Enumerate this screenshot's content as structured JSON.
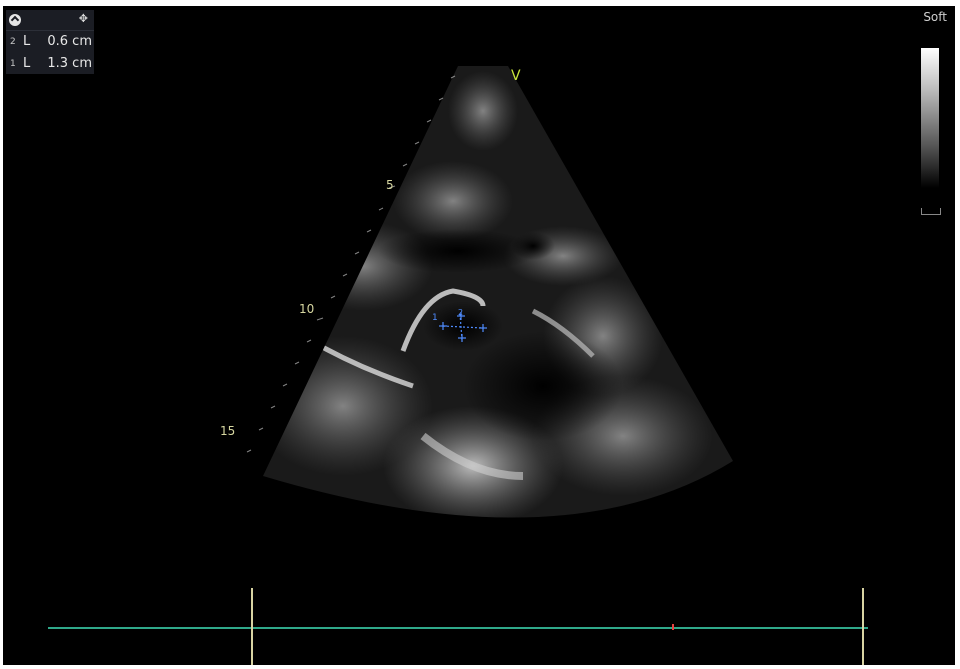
{
  "measurements": {
    "rows": [
      {
        "index": "2",
        "type": "L",
        "value": "0.6 cm"
      },
      {
        "index": "1",
        "type": "L",
        "value": "1.3 cm"
      }
    ],
    "icons": {
      "collapse": "collapse-circle-icon",
      "move": "move-arrows-icon"
    }
  },
  "preset": "Soft",
  "orientation_marker": "V",
  "depth_markers": [
    "5",
    "10",
    "15"
  ],
  "caliper_labels": [
    "1",
    "2"
  ],
  "colors": {
    "background": "#000000",
    "depth_text": "#d6d6a0",
    "orientation": "#c8e63c",
    "caliper": "#4f8cff",
    "timeline": "#2fa88a",
    "timeline_marker": "#e84040"
  }
}
